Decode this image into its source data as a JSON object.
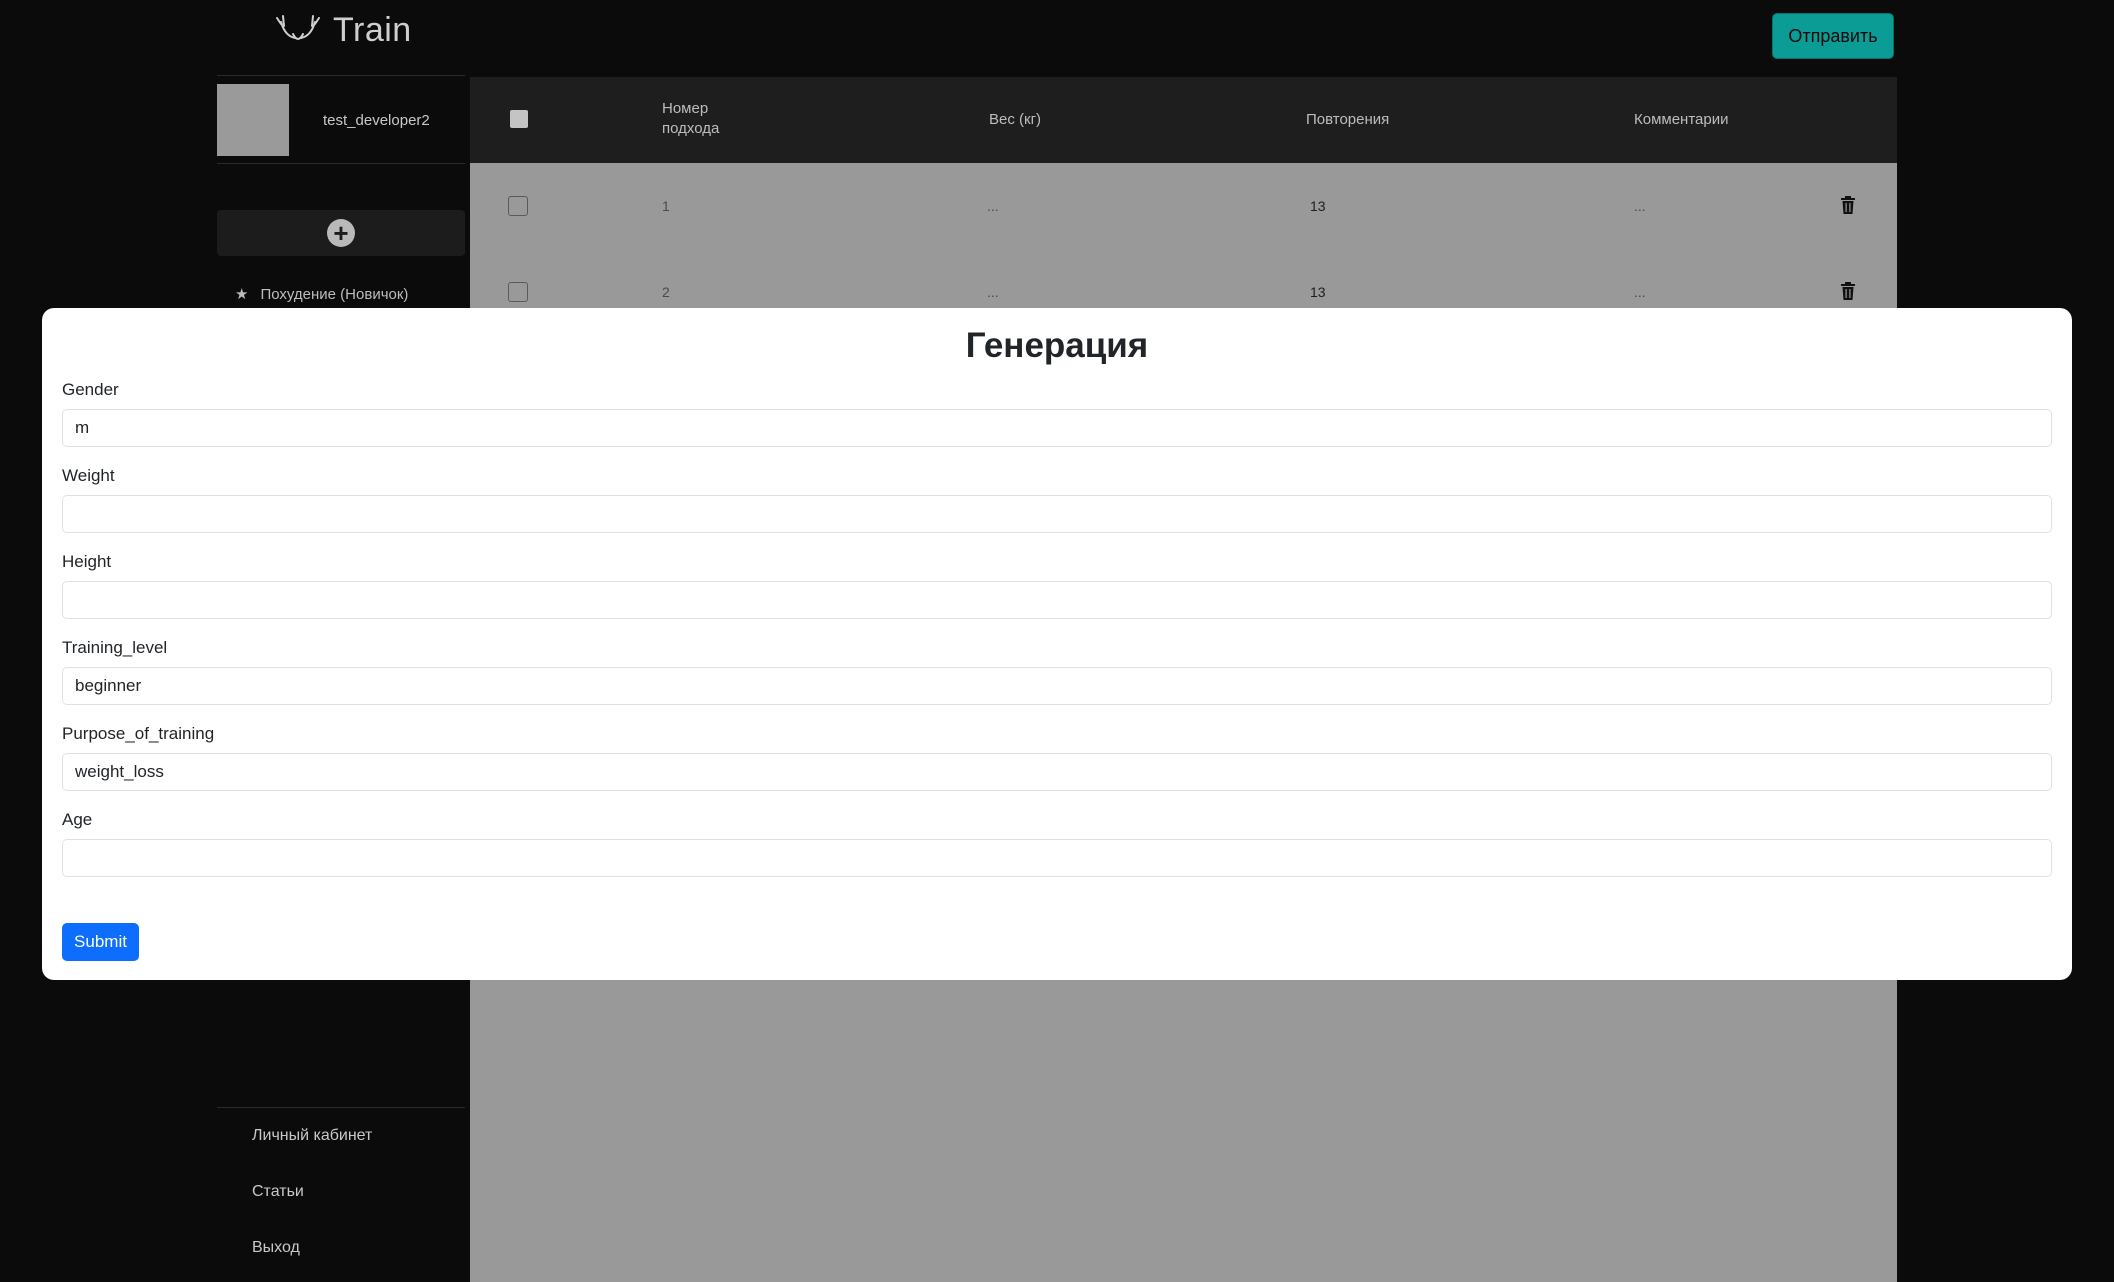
{
  "header": {
    "app_name": "Train",
    "send_label": "Отправить"
  },
  "sidebar": {
    "username": "test_developer2",
    "program": "Похудение (Новичок)",
    "links": [
      "Личный кабинет",
      "Статьи",
      "Выход"
    ]
  },
  "table": {
    "columns": [
      "Номер\nподхода",
      "Вес (кг)",
      "Повторения",
      "Комментарии"
    ],
    "rows": [
      {
        "set": "1",
        "weight": "...",
        "reps": "13",
        "comment": "..."
      },
      {
        "set": "2",
        "weight": "...",
        "reps": "13",
        "comment": "..."
      }
    ]
  },
  "modal": {
    "title": "Генерация",
    "fields": [
      {
        "label": "Gender",
        "value": "m"
      },
      {
        "label": "Weight",
        "value": ""
      },
      {
        "label": "Height",
        "value": ""
      },
      {
        "label": "Training_level",
        "value": "beginner"
      },
      {
        "label": "Purpose_of_training",
        "value": "weight_loss"
      },
      {
        "label": "Age",
        "value": ""
      }
    ],
    "submit_label": "Submit"
  }
}
